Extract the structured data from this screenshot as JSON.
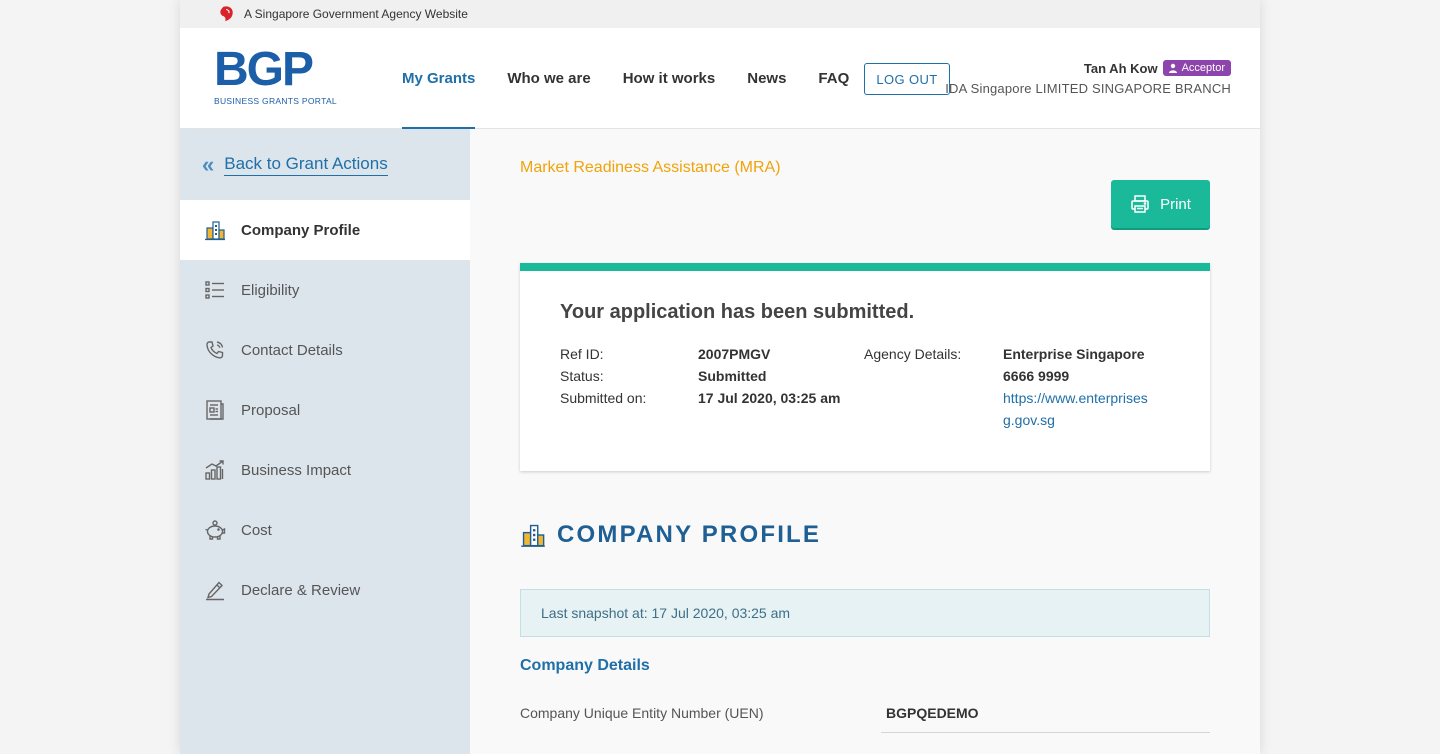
{
  "masthead": {
    "text": "A Singapore Government Agency Website"
  },
  "logo": {
    "letters": "BGP",
    "subtitle": "BUSINESS GRANTS PORTAL"
  },
  "nav": {
    "items": [
      "My Grants",
      "Who we are",
      "How it works",
      "News",
      "FAQ"
    ],
    "active": "My Grants"
  },
  "header": {
    "logout_label": "LOG OUT"
  },
  "user": {
    "name": "Tan Ah Kow",
    "role": "Acceptor",
    "org": "IDA Singapore LIMITED SINGAPORE BRANCH"
  },
  "sidebar": {
    "back_label": "Back to Grant Actions",
    "items": [
      {
        "label": "Company Profile",
        "icon": "building-icon"
      },
      {
        "label": "Eligibility",
        "icon": "checklist-icon"
      },
      {
        "label": "Contact Details",
        "icon": "phone-icon"
      },
      {
        "label": "Proposal",
        "icon": "document-icon"
      },
      {
        "label": "Business Impact",
        "icon": "bar-chart-icon"
      },
      {
        "label": "Cost",
        "icon": "piggy-bank-icon"
      },
      {
        "label": "Declare & Review",
        "icon": "pen-sign-icon"
      }
    ]
  },
  "main": {
    "grant_name": "Market Readiness Assistance (MRA)",
    "print_label": "Print",
    "submission": {
      "heading": "Your application has been submitted.",
      "ref_id_label": "Ref ID:",
      "ref_id": "2007PMGV",
      "status_label": "Status:",
      "status": "Submitted",
      "submitted_on_label": "Submitted on:",
      "submitted_on": "17 Jul 2020, 03:25 am",
      "agency_label": "Agency Details:",
      "agency_name": "Enterprise Singapore",
      "agency_phone": "6666 9999",
      "agency_url_line1": "https://www.enterprises",
      "agency_url_line2": "g.gov.sg"
    },
    "section_title": "COMPANY PROFILE",
    "snapshot": "Last snapshot at: 17 Jul 2020, 03:25 am",
    "details_title": "Company Details",
    "uen_label": "Company Unique Entity Number (UEN)",
    "uen_value": "BGPQEDEMO"
  },
  "colors": {
    "brand": "#1f6fa8",
    "accent": "#1ab99a",
    "grant": "#f0a30a",
    "role_badge": "#8e44ad"
  }
}
